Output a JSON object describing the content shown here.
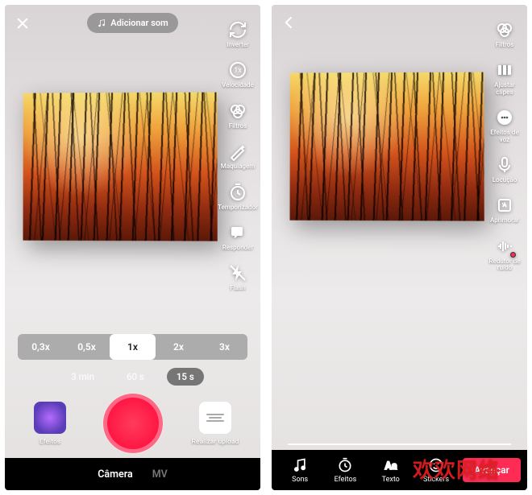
{
  "left": {
    "add_sound": "Adicionar som",
    "tools": [
      {
        "id": "flip",
        "label": "Inverter"
      },
      {
        "id": "speed",
        "label": "Velocidade"
      },
      {
        "id": "filters",
        "label": "Filtros"
      },
      {
        "id": "beauty",
        "label": "Maquiagem"
      },
      {
        "id": "timer",
        "label": "Temporizador"
      },
      {
        "id": "reply",
        "label": "Responder"
      },
      {
        "id": "flash",
        "label": "Flash"
      }
    ],
    "speeds": [
      "0,3x",
      "0,5x",
      "1x",
      "2x",
      "3x"
    ],
    "speed_active": 2,
    "durations": [
      "3 min",
      "60 s",
      "15 s"
    ],
    "duration_active": 2,
    "effects_label": "Efeitos",
    "upload_label": "Realizar upload",
    "nav": [
      {
        "label": "Câmera",
        "active": true
      },
      {
        "label": "MV",
        "active": false
      }
    ]
  },
  "right": {
    "tools": [
      {
        "id": "filters",
        "label": "Filtros"
      },
      {
        "id": "adjust",
        "label": "Ajustar clipes"
      },
      {
        "id": "voicefx",
        "label": "Efeitos de voz"
      },
      {
        "id": "voiceover",
        "label": "Locução"
      },
      {
        "id": "enhance",
        "label": "Aprimorar"
      },
      {
        "id": "noise",
        "label": "Redutor de ruído",
        "dot": true
      }
    ],
    "edit_items": [
      {
        "id": "sounds",
        "label": "Sons"
      },
      {
        "id": "effects",
        "label": "Efeitos"
      },
      {
        "id": "text",
        "label": "Texto"
      },
      {
        "id": "stickers",
        "label": "Stickers"
      }
    ],
    "next_label": "Avançar"
  },
  "watermark": "欢欢网络"
}
